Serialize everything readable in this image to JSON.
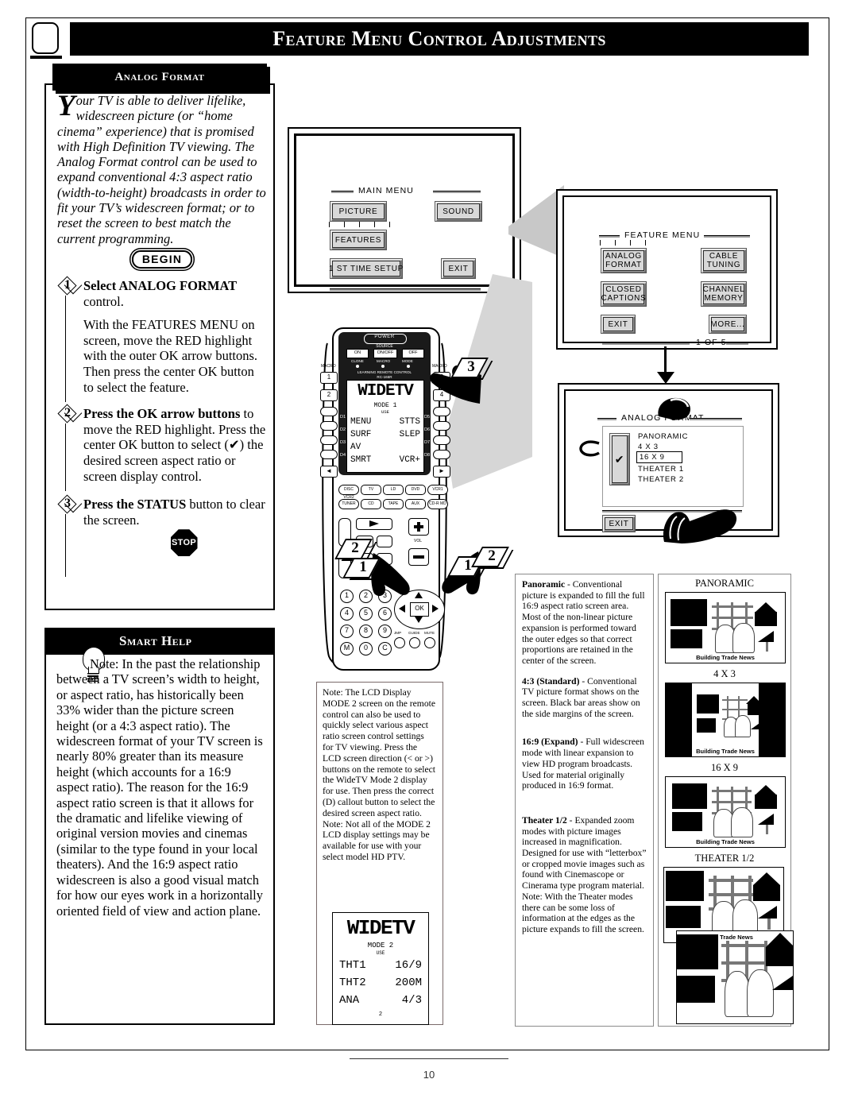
{
  "header": {
    "title": "Feature Menu Control Adjustments",
    "tv_icon": "tv-bullet-icon"
  },
  "left_column": {
    "tab_label": "Analog Format",
    "intro_dropcap": "Y",
    "intro_text": "our TV is able to deliver lifelike, widescreen picture (or “home cinema” experience) that is promised with High Definition TV viewing. The Analog Format control can be used to expand conventional 4:3 aspect ratio (width-to-height) broadcasts in order to fit your TV’s widescreen format; or to reset the screen to best match the current programming.",
    "begin_label": "BEGIN",
    "stop_label": "STOP",
    "steps": [
      {
        "number": "1",
        "heading": "Select ANALOG FORMAT",
        "body": " control.",
        "paragraph": "With the FEATURES MENU on screen, move the RED highlight with the outer OK arrow buttons. Then press the center OK button to select the feature."
      },
      {
        "number": "2",
        "heading": "Press the OK arrow buttons",
        "body": " to move the RED highlight. Press the center OK button to select (✔) the desired screen aspect ratio or screen display control.",
        "paragraph": ""
      },
      {
        "number": "3",
        "heading": "Press the STATUS",
        "body": " button to clear the screen.",
        "paragraph": ""
      }
    ]
  },
  "smart_help": {
    "title": "Smart Help",
    "icon": "lightbulb-icon",
    "text": "Note: In the past the relationship between a TV screen’s width to height, or aspect ratio, has historically been 33% wider than the picture screen height (or a 4:3 aspect ratio). The widescreen format of your TV screen is nearly 80% greater than its measure height (which accounts for a 16:9 aspect ratio). The reason for the 16:9 aspect ratio screen is that it allows for the dramatic and lifelike viewing of original version movies and cinemas (similar to the type found in your local theaters). And the 16:9 aspect ratio widescreen is also a good visual match for how our eyes work in a horizontally oriented field of view and action plane."
  },
  "main_menu_screen": {
    "title": "MAIN MENU",
    "buttons": [
      {
        "label": "PICTURE",
        "highlighted": false
      },
      {
        "label": "SOUND",
        "highlighted": false
      },
      {
        "label": "FEATURES",
        "highlighted": true
      },
      {
        "label": "1 ST TIME SETUP",
        "highlighted": false
      },
      {
        "label": "EXIT",
        "highlighted": false
      }
    ]
  },
  "feature_menu_screen": {
    "title": "FEATURE MENU",
    "page_indicator": "1 OF 5",
    "buttons": [
      {
        "line1": "ANALOG",
        "line2": "FORMAT",
        "highlighted": true
      },
      {
        "line1": "CABLE",
        "line2": "TUNING",
        "highlighted": false
      },
      {
        "line1": "CLOSED",
        "line2": "CAPTIONS",
        "highlighted": false
      },
      {
        "line1": "CHANNEL",
        "line2": "MEMORY",
        "highlighted": false
      },
      {
        "line1": "EXIT",
        "line2": "",
        "highlighted": false
      },
      {
        "line1": "MORE...",
        "line2": "",
        "highlighted": false
      }
    ]
  },
  "analog_format_screen": {
    "title": "ANALOG FORMAT",
    "exit_label": "EXIT",
    "check_mark": "✔",
    "options": [
      {
        "label": "PANORAMIC",
        "selected": false
      },
      {
        "label": "4 X 3",
        "selected": false
      },
      {
        "label": "16 X 9",
        "selected": true
      },
      {
        "label": "THEATER 1",
        "selected": false
      },
      {
        "label": "THEATER 2",
        "selected": false
      }
    ]
  },
  "remote": {
    "model_text": "LEARNING REMOTE CONTROL",
    "model_number": "RC-166R",
    "power_label": "POWER",
    "source_label": "SOURCE",
    "power_buttons": [
      "ON",
      "ON/OFF",
      "OFF"
    ],
    "indicator_labels": [
      "CLONE",
      "MACRO",
      "MODE"
    ],
    "macro_label": "MACRO",
    "side_number_buttons": [
      "1",
      "2",
      "3",
      "4"
    ],
    "lcd": {
      "brand": "WIDETV",
      "mode": "MODE 1",
      "use": "USE",
      "rows": [
        {
          "d_left": "D1",
          "left": "MENU",
          "right": "STTS",
          "d_right": "D5"
        },
        {
          "d_left": "D2",
          "left": "SURF",
          "right": "SLEP",
          "d_right": "D6"
        },
        {
          "d_left": "D3",
          "left": "AV",
          "right": "",
          "d_right": "D7"
        },
        {
          "d_left": "D4",
          "left": "SMRT",
          "right": "VCR+",
          "d_right": "D8"
        }
      ]
    },
    "device_row_1": [
      "DISC VCR2",
      "TV",
      "LD",
      "DVD",
      "VCR1"
    ],
    "device_row_2": [
      "TUNER",
      "CD",
      "TAPE",
      "AUX",
      "CD-R MD"
    ],
    "vol_label": "VOL",
    "ok_label": "OK",
    "keypad": [
      "1",
      "2",
      "3",
      "4",
      "5",
      "6",
      "7",
      "8",
      "9",
      "M",
      "0",
      "C"
    ],
    "bottom_buttons": [
      "JMP",
      "GUIDE",
      "MUTE"
    ],
    "callouts": [
      "3",
      "2",
      "1",
      "1",
      "2"
    ]
  },
  "remote_note": {
    "text": "Note: The LCD Display MODE 2 screen on the remote control can also be used to quickly select various aspect ratio screen control settings for TV viewing. Press the LCD screen direction (< or >) buttons on the remote to select the WideTV Mode 2 display for use. Then press the correct (D) callout button to select the desired screen aspect ratio. Note: Not all of the MODE 2 LCD display settings may be available for use with your select model HD PTV."
  },
  "lcd_mode2": {
    "brand": "WIDETV",
    "mode": "MODE 2",
    "use": "USE",
    "page": "2",
    "rows": [
      {
        "left": "THT1",
        "right": "16/9"
      },
      {
        "left": "THT2",
        "right": "200M"
      },
      {
        "left": "ANA",
        "right": "4/3"
      }
    ]
  },
  "descriptions": [
    {
      "term": "Panoramic",
      "text": " - Conventional picture is expanded to fill the full 16:9 aspect ratio screen area. Most of the non-linear picture expansion is performed toward the outer edges so that correct proportions are retained in the center of the screen."
    },
    {
      "term": "4:3 (Standard)",
      "text": " - Conventional TV picture format shows on the screen. Black bar areas show on the side margins of the screen."
    },
    {
      "term": "16:9 (Expand)",
      "text": " - Full widescreen mode with linear expansion to view HD program broadcasts. Used for material originally produced in 16:9 format."
    },
    {
      "term": "Theater 1/2",
      "text": " - Expanded zoom modes with picture images increased in magnification. Designed for use with “letterbox” or cropped movie images such as found with Cinemascope or Cinerama type program material. Note: With the Theater modes there can be some loss of information at the edges as the picture expands to fill the screen."
    }
  ],
  "thumbnails": [
    {
      "label": "PANORAMIC",
      "caption": "Building Trade News",
      "bars": false
    },
    {
      "label": "4 X 3",
      "caption": "Building Trade News",
      "bars": true
    },
    {
      "label": "16 X 9",
      "caption": "Building Trade News",
      "bars": false
    },
    {
      "label": "THEATER 1/2",
      "caption": "Building Trade News",
      "bars": false
    },
    {
      "label": "",
      "caption": "",
      "bars": false
    }
  ],
  "page_number": "10"
}
